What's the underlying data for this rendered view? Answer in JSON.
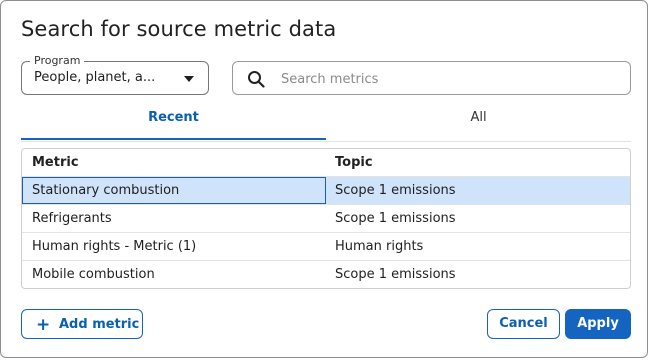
{
  "dialog": {
    "title": "Search for source metric data"
  },
  "program": {
    "label": "Program",
    "value": "People, planet, a..."
  },
  "search": {
    "placeholder": "Search metrics",
    "value": ""
  },
  "tabs": [
    {
      "label": "Recent",
      "active": true
    },
    {
      "label": "All",
      "active": false
    }
  ],
  "table": {
    "columns": [
      "Metric",
      "Topic"
    ],
    "rows": [
      {
        "metric": "Stationary combustion",
        "topic": "Scope 1 emissions",
        "selected": true
      },
      {
        "metric": "Refrigerants",
        "topic": "Scope 1 emissions",
        "selected": false
      },
      {
        "metric": "Human rights - Metric (1)",
        "topic": "Human rights",
        "selected": false
      },
      {
        "metric": "Mobile combustion",
        "topic": "Scope 1 emissions",
        "selected": false
      }
    ]
  },
  "footer": {
    "add_label": "Add metric",
    "cancel_label": "Cancel",
    "apply_label": "Apply"
  },
  "colors": {
    "accent": "#1565c0",
    "selected_row": "#cfe3fb"
  }
}
